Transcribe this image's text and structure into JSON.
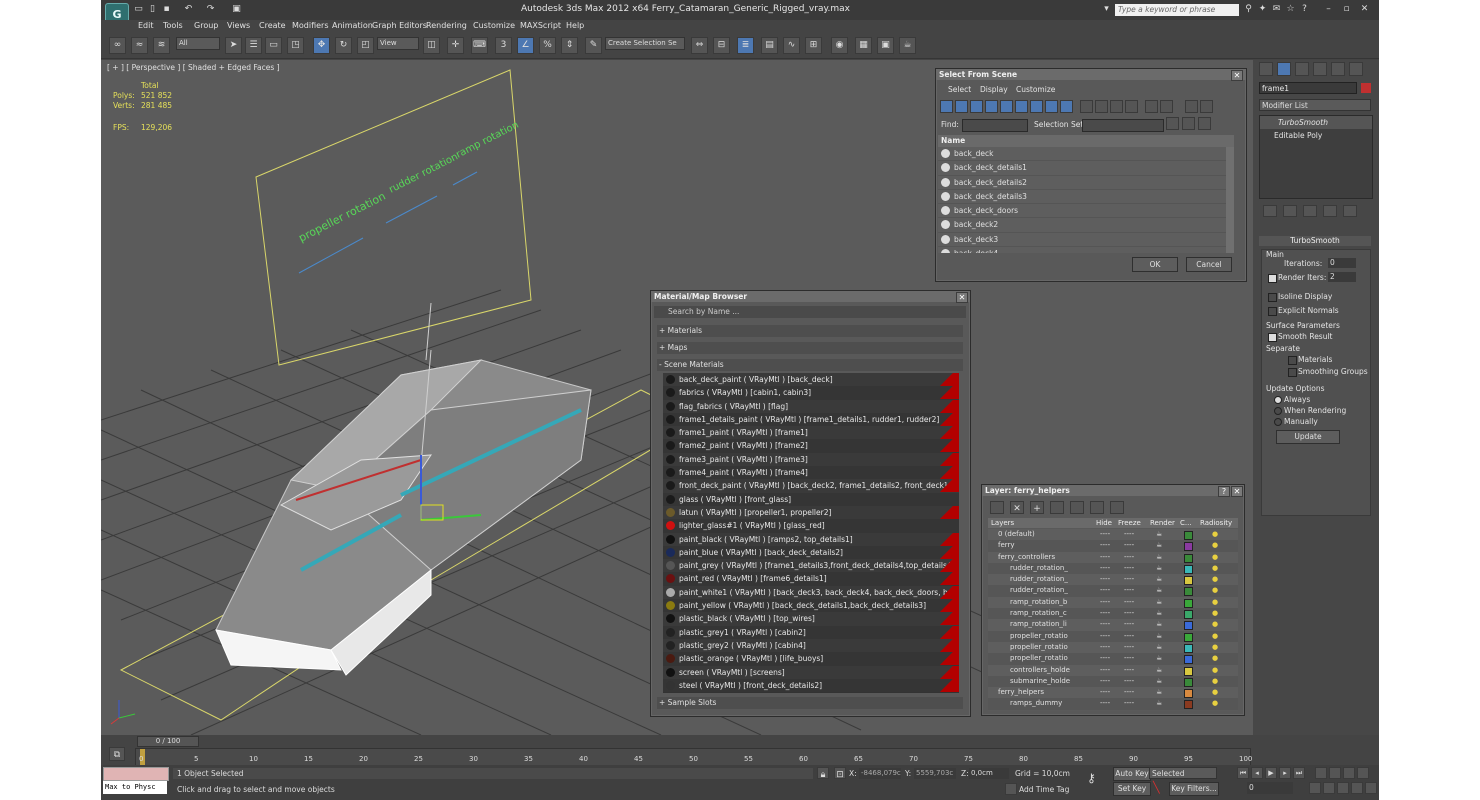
{
  "app": {
    "title": "Autodesk 3ds Max  2012 x64     Ferry_Catamaran_Generic_Rigged_vray.max",
    "logo": "G"
  },
  "search": {
    "placeholder": "Type a keyword or phrase"
  },
  "menu": [
    "Edit",
    "Tools",
    "Group",
    "Views",
    "Create",
    "Modifiers",
    "Animation",
    "Graph Editors",
    "Rendering",
    "Customize",
    "MAXScript",
    "Help"
  ],
  "toolbar": {
    "selection_filter": "All",
    "ref_coord": "View",
    "named_selection": "Create Selection Se"
  },
  "viewport": {
    "label": "[ + ] [ Perspective ] [ Shaded + Edged Faces ]",
    "stats": {
      "total_label": "Total",
      "polys_label": "Polys:",
      "polys": "521 852",
      "verts_label": "Verts:",
      "verts": "281 485",
      "fps_label": "FPS:",
      "fps": "129,206"
    },
    "sliders": [
      "propeller rotation",
      "rudder rotation",
      "ramp rotation"
    ]
  },
  "select_from_scene": {
    "title": "Select From Scene",
    "menu": [
      "Select",
      "Display",
      "Customize"
    ],
    "find_label": "Find:",
    "selection_set_label": "Selection Set:",
    "column": "Name",
    "items": [
      "back_deck",
      "back_deck_details1",
      "back_deck_details2",
      "back_deck_details3",
      "back_deck_doors",
      "back_deck2",
      "back_deck3",
      "back_deck4"
    ],
    "ok": "OK",
    "cancel": "Cancel"
  },
  "material_browser": {
    "title": "Material/Map Browser",
    "search_placeholder": "Search by Name ...",
    "groups": {
      "materials": "+ Materials",
      "maps": "+ Maps",
      "scene": "- Scene Materials",
      "sample": "+ Sample Slots"
    },
    "items": [
      {
        "label": "back_deck_paint  ( VRayMtl )  [back_deck]",
        "color": "#1a1a1a",
        "red": true
      },
      {
        "label": "fabrics  ( VRayMtl )  [cabin1, cabin3]",
        "color": "#1a1a1a",
        "red": true
      },
      {
        "label": "flag_fabrics  ( VRayMtl )  [flag]",
        "color": "#1a1a1a",
        "red": true
      },
      {
        "label": "frame1_details_paint  ( VRayMtl )  [frame1_details1, rudder1, rudder2]",
        "color": "#1a1a1a",
        "red": true
      },
      {
        "label": "frame1_paint  ( VRayMtl )  [frame1]",
        "color": "#1a1a1a",
        "red": true
      },
      {
        "label": "frame2_paint  ( VRayMtl )  [frame2]",
        "color": "#1a1a1a",
        "red": true
      },
      {
        "label": "frame3_paint  ( VRayMtl )  [frame3]",
        "color": "#1a1a1a",
        "red": true
      },
      {
        "label": "frame4_paint  ( VRayMtl )  [frame4]",
        "color": "#1a1a1a",
        "red": true
      },
      {
        "label": "front_deck_paint  ( VRayMtl )  [back_deck2, frame1_details2, front_deck]",
        "color": "#1a1a1a",
        "red": true
      },
      {
        "label": "glass  ( VRayMtl )  [front_glass]",
        "color": "#1a1a1a",
        "red": false
      },
      {
        "label": "latun  ( VRayMtl )  [propeller1, propeller2]",
        "color": "#6b5a2a",
        "red": true
      },
      {
        "label": "lighter_glass#1  ( VRayMtl )  [glass_red]",
        "color": "#d01010",
        "red": false
      },
      {
        "label": "paint_black  ( VRayMtl )  [ramps2, top_details1]",
        "color": "#111111",
        "red": true
      },
      {
        "label": "paint_blue  ( VRayMtl )  [back_deck_details2]",
        "color": "#1a2a5a",
        "red": true
      },
      {
        "label": "paint_grey  ( VRayMtl )  [frame1_details3,front_deck_details4,top_details4]",
        "color": "#555555",
        "red": true
      },
      {
        "label": "paint_red  ( VRayMtl )  [frame6_details1]",
        "color": "#6a1010",
        "red": true
      },
      {
        "label": "paint_white1  ( VRayMtl )  [back_deck3, back_deck4, back_deck_doors, back_rail...",
        "color": "#aaaaaa",
        "red": true
      },
      {
        "label": "paint_yellow  ( VRayMtl )  [back_deck_details1,back_deck_details3]",
        "color": "#8a7a10",
        "red": true
      },
      {
        "label": "plastic_black  ( VRayMtl )  [top_wires]",
        "color": "#111111",
        "red": true
      },
      {
        "label": "plastic_grey1  ( VRayMtl )  [cabin2]",
        "color": "#222222",
        "red": true
      },
      {
        "label": "plastic_grey2  ( VRayMtl )  [cabin4]",
        "color": "#222222",
        "red": true
      },
      {
        "label": "plastic_orange  ( VRayMtl )  [life_buoys]",
        "color": "#4a1a10",
        "red": true
      },
      {
        "label": "screen  ( VRayMtl )  [screens]",
        "color": "#111111",
        "red": true
      },
      {
        "label": "steel  ( VRayMtl )  [front_deck_details2]",
        "color": "#333333",
        "red": true
      }
    ]
  },
  "layer_manager": {
    "title": "Layer: ferry_helpers",
    "columns": [
      "Layers",
      "Hide",
      "Freeze",
      "Render",
      "C...",
      "Radiosity"
    ],
    "rows": [
      {
        "name": "0 (default)",
        "indent": 0,
        "color": "#3a8a3a"
      },
      {
        "name": "ferry",
        "indent": 0,
        "color": "#8a3aa0"
      },
      {
        "name": "ferry_controllers",
        "indent": 0,
        "color": "#3a8a3a"
      },
      {
        "name": "rudder_rotation_",
        "indent": 1,
        "color": "#3ab8b8"
      },
      {
        "name": "rudder_rotation_",
        "indent": 1,
        "color": "#d8c840"
      },
      {
        "name": "rudder_rotation_",
        "indent": 1,
        "color": "#3a8a3a"
      },
      {
        "name": "ramp_rotation_b",
        "indent": 1,
        "color": "#3aa83a"
      },
      {
        "name": "ramp_rotation_c",
        "indent": 1,
        "color": "#3aa86a"
      },
      {
        "name": "ramp_rotation_li",
        "indent": 1,
        "color": "#3a6ad8"
      },
      {
        "name": "propeller_rotatio",
        "indent": 1,
        "color": "#3aa83a"
      },
      {
        "name": "propeller_rotatio",
        "indent": 1,
        "color": "#3ab8b8"
      },
      {
        "name": "propeller_rotatio",
        "indent": 1,
        "color": "#3a6ad8"
      },
      {
        "name": "controllers_holde",
        "indent": 1,
        "color": "#d8c840"
      },
      {
        "name": "submarine_holde",
        "indent": 1,
        "color": "#3a8a3a"
      },
      {
        "name": "ferry_helpers",
        "indent": 0,
        "color": "#d88a40"
      },
      {
        "name": "ramps_dummy",
        "indent": 1,
        "color": "#8a3a20"
      }
    ]
  },
  "command_panel": {
    "object_name": "frame1",
    "modifier_list": "Modifier List",
    "stack": [
      "TurboSmooth",
      "Editable Poly"
    ],
    "rollout_title": "TurboSmooth",
    "main_label": "Main",
    "iterations_label": "Iterations:",
    "iterations": "0",
    "render_iters_label": "Render Iters:",
    "render_iters": "2",
    "isoline": "Isoline Display",
    "explicit": "Explicit Normals",
    "surface_params": "Surface Parameters",
    "smooth_result": "Smooth Result",
    "separate": "Separate",
    "materials": "Materials",
    "smoothing_groups": "Smoothing Groups",
    "update_options": "Update Options",
    "always": "Always",
    "when_rendering": "When Rendering",
    "manually": "Manually",
    "update_btn": "Update"
  },
  "timeline": {
    "frame": "0 / 100",
    "ticks": [
      "0",
      "5",
      "10",
      "15",
      "20",
      "25",
      "30",
      "35",
      "40",
      "45",
      "50",
      "55",
      "60",
      "65",
      "70",
      "75",
      "80",
      "85",
      "90",
      "95",
      "100"
    ]
  },
  "status": {
    "maxscript": "Max to Physc",
    "selected": "1 Object Selected",
    "prompt": "Click and drag to select and move objects",
    "x_label": "X:",
    "x": "-8468,079c",
    "y_label": "Y:",
    "y": "5559,703c",
    "z_label": "Z:",
    "z": "0,0cm",
    "grid": "Grid = 10,0cm",
    "add_time_tag": "Add Time Tag",
    "auto_key": "Auto Key",
    "set_key": "Set Key",
    "key_mode": "Selected",
    "key_filters": "Key Filters...",
    "frame": "0"
  }
}
